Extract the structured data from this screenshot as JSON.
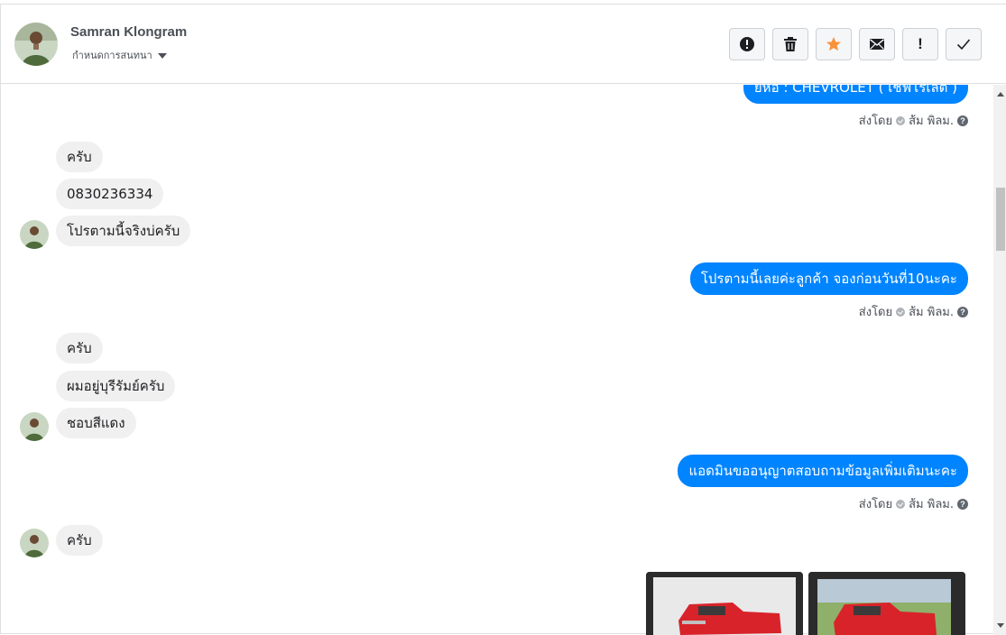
{
  "contact": {
    "name": "Samran Klongram",
    "subtitle": "กำหนดการสนทนา"
  },
  "toolbar": {
    "buttons": [
      {
        "icon": "alert-circle-icon"
      },
      {
        "icon": "trash-icon"
      },
      {
        "icon": "star-icon",
        "color": "#f7923b"
      },
      {
        "icon": "envelope-icon"
      },
      {
        "icon": "exclamation-icon",
        "label": "!"
      },
      {
        "icon": "checkmark-icon"
      }
    ]
  },
  "messages": {
    "out_0_text": "ยี่ห้อ : CHEVROLET ( เชฟโรเลต )",
    "meta_0": {
      "sent_by": "ส่งโดย",
      "agent": "ส้ม พิลม."
    },
    "in_0": "ครับ",
    "in_1": "0830236334",
    "in_2": "โปรตามนี้จริงบ่ครับ",
    "out_1_text": "โปรตามนี้เลยค่ะลูกค้า จองก่อนวันที่10นะคะ",
    "meta_1": {
      "sent_by": "ส่งโดย",
      "agent": "ส้ม พิลม."
    },
    "in_3": "ครับ",
    "in_4": "ผมอยู่บุรีรัมย์ครับ",
    "in_5": "ชอบสีแดง",
    "out_2_text": "แอดมินขออนุญาตสอบถามข้อมูลเพิ่มเติมนะคะ",
    "meta_2": {
      "sent_by": "ส่งโดย",
      "agent": "ส้ม พิลม."
    },
    "in_6": "ครับ"
  },
  "colors": {
    "outgoing_bubble": "#0084ff",
    "incoming_bubble": "#f1f0f0"
  }
}
